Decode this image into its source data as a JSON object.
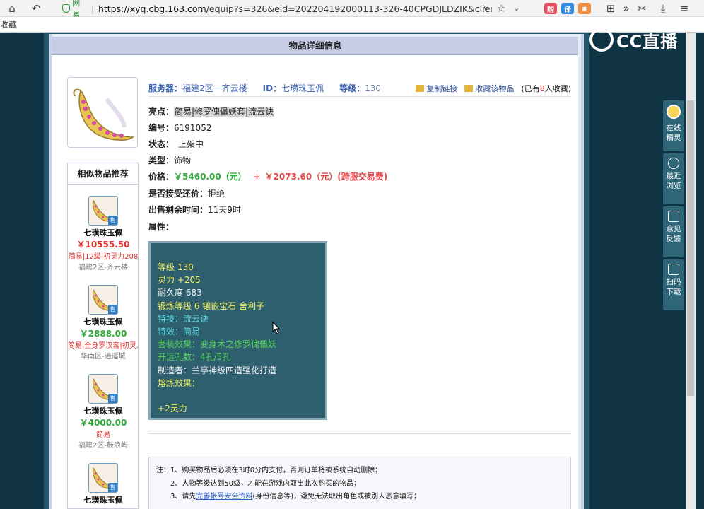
{
  "browser": {
    "secure_label": "网易",
    "url_host": "https://xyq.cbg.163.com",
    "url_path": "/equip?s=326&eid=202204192000113-326-40CPGDJLDZIK&client_typ",
    "bookmark_label": "收藏"
  },
  "header": {
    "title": "物品详细信息"
  },
  "item": {
    "server_key": "服务器：",
    "server_val": "福建2区一齐云楼",
    "id_key": "ID：",
    "id_val": "七璜珠玉佩",
    "level_key": "等级：",
    "level_val": "130",
    "copy_link": "复制链接",
    "collect": "收藏该物品",
    "fav_pre": "(已有",
    "fav_num": "8",
    "fav_post": "人收藏)",
    "highlight_key": "亮点：",
    "highlight_val": "简易|修罗傀儡妖套|流云诀",
    "number_key": "编号：",
    "number_val": "6191052",
    "status_key": "状态：",
    "status_val": "上架中",
    "type_key": "类型：",
    "type_val": "饰物",
    "price_key": "价格：",
    "price_main": "￥5460.00（元）",
    "price_plus": "+",
    "price_fee": "￥2073.60（元）(跨服交易费)",
    "bargain_key": "是否接受还价：",
    "bargain_val": "拒绝",
    "remain_key": "出售剩余时间：",
    "remain_val": "11天9时",
    "attr_key": "属性："
  },
  "attributes": [
    {
      "text": "等级 130",
      "color": "y"
    },
    {
      "text": "灵力 +205",
      "color": "y"
    },
    {
      "text": "耐久度 683",
      "color": "w"
    },
    {
      "text": "锻炼等级 6 镶嵌宝石 舍利子",
      "color": "y"
    },
    {
      "text": "特技：流云诀",
      "color": "c"
    },
    {
      "text": "特效：简易",
      "color": "c"
    },
    {
      "text": "套装效果：变身术之修罗傀儡妖",
      "color": "g"
    },
    {
      "text": "开运孔数：4孔/5孔",
      "color": "g"
    },
    {
      "text": "制造者：兰亭神级四造强化打造",
      "color": "w"
    },
    {
      "text": "熔炼效果：",
      "color": "y"
    },
    {
      "text": "",
      "color": "y"
    },
    {
      "text": "+2灵力",
      "color": "y"
    }
  ],
  "similar": {
    "title": "相似物品推荐",
    "sell_tag": "售",
    "items": [
      {
        "name": "七璜珠玉佩",
        "price": "￥10555.50",
        "price_color": "#e0312c",
        "tags": "简易|12级|初灵力208",
        "server": "福建2区-齐云楼"
      },
      {
        "name": "七璜珠玉佩",
        "price": "￥2888.00",
        "price_color": "#2fa83a",
        "tags": "简易|全身罗汉套|初灵…",
        "server": "华南区-逍遥城"
      },
      {
        "name": "七璜珠玉佩",
        "price": "￥4000.00",
        "price_color": "#2fa83a",
        "tags": "简易",
        "server": "福建2区-鼓浪屿"
      },
      {
        "name": "七璜珠玉佩",
        "price": "",
        "price_color": "#2fa83a",
        "tags": "",
        "server": ""
      }
    ]
  },
  "notes": {
    "line1": "注：1、购买物品后必须在3时0分内支付，否则订单将被系统自动删除；",
    "line2": "2、人物等级达到50级，才能在游戏内取出此次购买的物品；",
    "line3_pre": "3、请先",
    "line3_link": "完善帐号安全资料",
    "line3_post": "(身份信息等)，避免无法取出角色或被别人恶意填写；"
  },
  "cc_banner": {
    "text": "CC直播"
  },
  "floating_panel": {
    "online": "在线精灵",
    "recent": "最近浏览",
    "feedback": "意见反馈",
    "download": "扫码下载"
  }
}
